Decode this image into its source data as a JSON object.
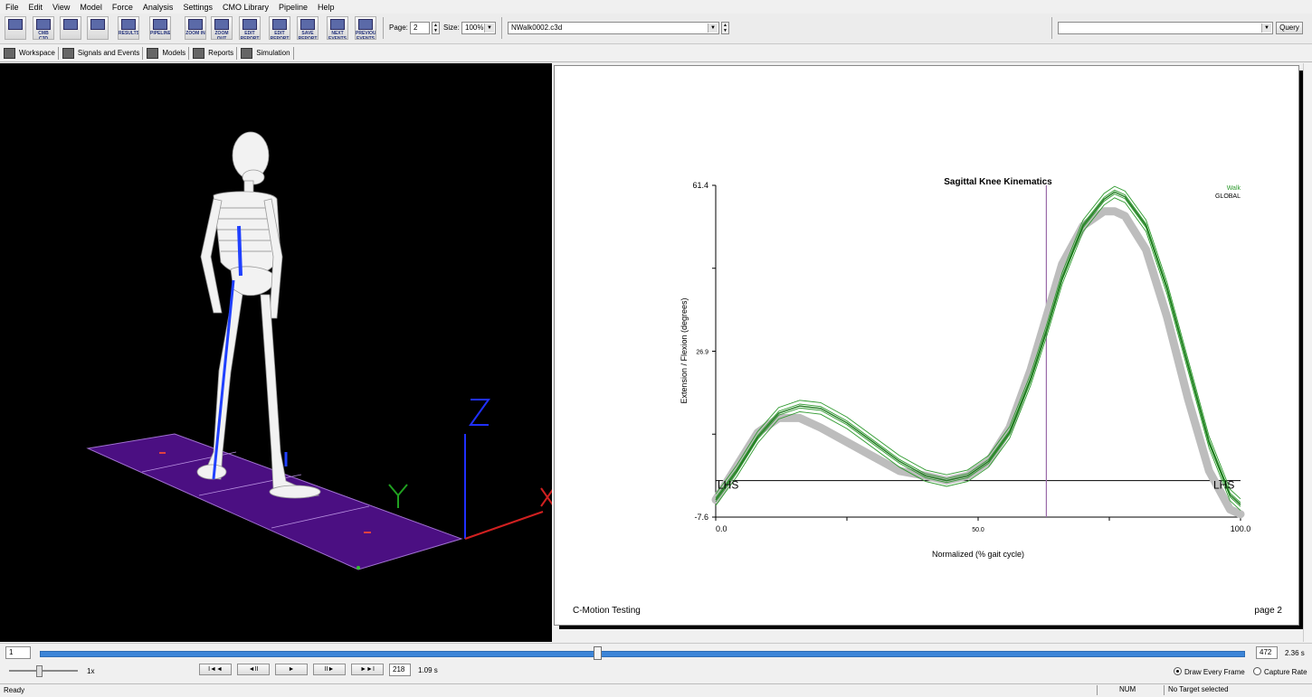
{
  "menu": [
    "File",
    "Edit",
    "View",
    "Model",
    "Force",
    "Analysis",
    "Settings",
    "CMO Library",
    "Pipeline",
    "Help"
  ],
  "toolbar": {
    "buttons": [
      {
        "name": "new",
        "label": ""
      },
      {
        "name": "open",
        "label": "CMB C3D"
      },
      {
        "name": "save",
        "label": ""
      },
      {
        "name": "print",
        "label": ""
      },
      {
        "name": "results",
        "label": "RESULTS"
      },
      {
        "name": "pipeline",
        "label": "PIPELINE"
      },
      {
        "name": "zoom-in",
        "label": "ZOOM IN"
      },
      {
        "name": "zoom-out",
        "label": "ZOOM OUT"
      },
      {
        "name": "edit-report",
        "label": "EDIT REPORT"
      },
      {
        "name": "edit-report-2",
        "label": "EDIT REPORT"
      },
      {
        "name": "save-report",
        "label": "SAVE REPORT"
      },
      {
        "name": "next-events",
        "label": "NEXT EVENTS"
      },
      {
        "name": "prev-events",
        "label": "PREVIOUS EVENTS"
      }
    ],
    "page_label": "Page:",
    "page_value": "2",
    "size_label": "Size:",
    "size_value": "100%",
    "file_value": "NWalk0002.c3d",
    "query_value": "",
    "query_button": "Query"
  },
  "tabs": [
    "Workspace",
    "Signals and Events",
    "Models",
    "Reports",
    "Simulation"
  ],
  "report": {
    "title": "Sagittal Knee Kinematics",
    "legend": [
      "Walk",
      "GLOBAL"
    ],
    "footer_left": "C-Motion Testing",
    "footer_right": "page 2"
  },
  "chart_data": {
    "type": "line",
    "title": "Sagittal Knee Kinematics",
    "xlabel": "Normalized (% gait cycle)",
    "ylabel": "Extension / Flexion (degrees)",
    "xlim": [
      0,
      100
    ],
    "ylim": [
      -7.6,
      61.4
    ],
    "yticks": [
      "61.4",
      "26.9",
      "-7.6"
    ],
    "xticks": [
      "0.0",
      "50.0",
      "100.0"
    ],
    "event_markers": [
      {
        "label": "LHS",
        "x": 0
      },
      {
        "label": "LHS",
        "x": 100
      }
    ],
    "vertical_marker_x": 63,
    "series": [
      {
        "name": "Walk",
        "color": "#2e9a2e",
        "x": [
          0,
          4,
          8,
          12,
          16,
          20,
          25,
          30,
          35,
          40,
          44,
          48,
          52,
          56,
          60,
          63,
          66,
          70,
          74,
          76,
          78,
          82,
          86,
          90,
          94,
          98,
          100
        ],
        "y": [
          -4,
          2,
          9,
          14,
          15.5,
          15,
          12,
          8,
          4,
          1,
          0,
          1,
          4,
          10,
          21,
          31,
          42,
          53,
          58.5,
          60,
          59,
          53,
          40,
          24,
          8,
          -3,
          -5
        ]
      },
      {
        "name": "GLOBAL",
        "color": "#bdbdbd",
        "x": [
          0,
          4,
          8,
          12,
          16,
          20,
          25,
          30,
          35,
          40,
          44,
          48,
          52,
          56,
          60,
          63,
          66,
          70,
          74,
          76,
          78,
          82,
          86,
          90,
          94,
          98,
          100
        ],
        "y": [
          -4,
          3,
          10,
          13,
          13,
          11,
          8,
          5,
          2,
          1,
          0,
          1,
          4,
          11,
          23,
          34,
          45,
          53,
          56,
          56,
          55,
          48,
          34,
          17,
          2,
          -6,
          -7
        ]
      }
    ]
  },
  "timeline": {
    "start_frame": "1",
    "end_frame": "472",
    "end_time": "2.36 s",
    "current_frame": "218",
    "current_time": "1.09 s",
    "speed": "1x",
    "playback_buttons": [
      "I◄◄",
      "◄II",
      "►",
      "II►",
      "►►I"
    ],
    "draw_every_frame": "Draw Every Frame",
    "capture_rate": "Capture Rate",
    "progress": 0.46
  },
  "status": {
    "left": "Ready",
    "num": "NUM",
    "target": "No Target selected"
  }
}
